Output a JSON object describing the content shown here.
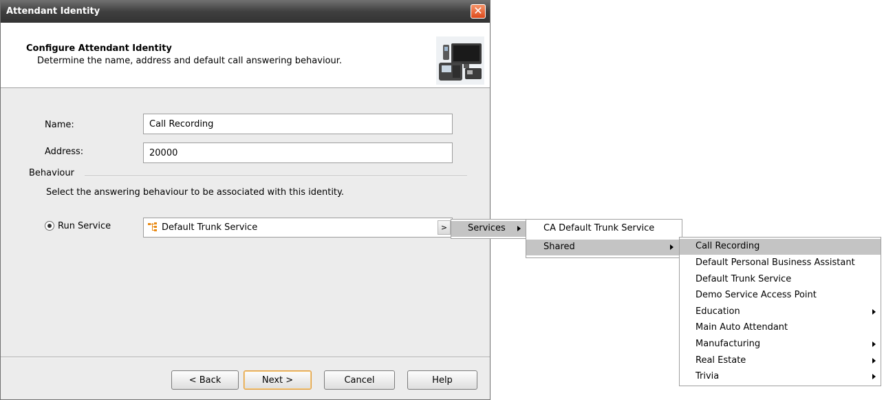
{
  "window": {
    "title": "Attendant Identity",
    "close_glyph": "✕"
  },
  "header": {
    "title": "Configure Attendant Identity",
    "subtitle": "Determine the name, address and default call answering behaviour.",
    "icon": "phone-devices-icon"
  },
  "form": {
    "name_label": "Name:",
    "name_value": "Call Recording",
    "address_label": "Address:",
    "address_value": "20000"
  },
  "behaviour": {
    "group_label": "Behaviour",
    "description": "Select the answering behaviour to be associated with this identity.",
    "radio_label": "Run Service",
    "radio_selected": true,
    "service_value": "Default Trunk Service",
    "service_icon": "service-tree-icon",
    "arrow_glyph": ">"
  },
  "buttons": {
    "back": "< Back",
    "next": "Next >",
    "cancel": "Cancel",
    "help": "Help"
  },
  "menus": {
    "level1": [
      {
        "label": "Services",
        "has_submenu": true,
        "highlighted": true
      }
    ],
    "level2": [
      {
        "label": "CA Default Trunk Service",
        "has_submenu": false,
        "highlighted": false
      },
      {
        "label": "Shared",
        "has_submenu": true,
        "highlighted": true
      }
    ],
    "level3": [
      {
        "label": "Call Recording",
        "has_submenu": false,
        "highlighted": true
      },
      {
        "label": "Default Personal Business Assistant",
        "has_submenu": false,
        "highlighted": false
      },
      {
        "label": "Default Trunk Service",
        "has_submenu": false,
        "highlighted": false
      },
      {
        "label": "Demo Service Access Point",
        "has_submenu": false,
        "highlighted": false
      },
      {
        "label": "Education",
        "has_submenu": true,
        "highlighted": false
      },
      {
        "label": "Main Auto Attendant",
        "has_submenu": false,
        "highlighted": false
      },
      {
        "label": "Manufacturing",
        "has_submenu": true,
        "highlighted": false
      },
      {
        "label": "Real Estate",
        "has_submenu": true,
        "highlighted": false
      },
      {
        "label": "Trivia",
        "has_submenu": true,
        "highlighted": false
      }
    ]
  },
  "colors": {
    "titlebar": "#3f3f3f",
    "close": "#dd4a1c",
    "menu_highlight": "#c4c4c4",
    "default_button_border": "#e09a3a"
  }
}
